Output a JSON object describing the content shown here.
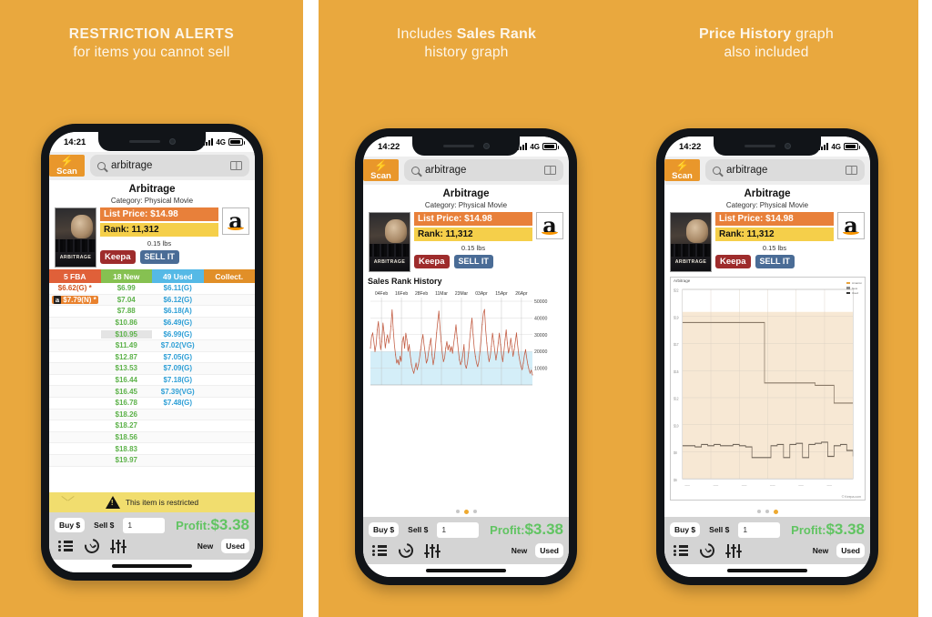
{
  "colors": {
    "promo_bg": "#e9a83e",
    "scan_orange": "#e9972b",
    "price_bar": "#e8803a",
    "rank_bar": "#f5cf4a",
    "profit_green": "#61c462",
    "restrict_yellow": "#f1dd6e",
    "fba_header": "#e06039",
    "new_header": "#86c151",
    "used_header": "#55b9e6",
    "collect_header": "#e18f28"
  },
  "panels": [
    {
      "id": "restriction-alerts",
      "promo": {
        "line1": "RESTRICTION ALERTS",
        "line2": "for items you cannot sell",
        "line1_bold": true
      },
      "status": {
        "time": "14:21",
        "network": "4G"
      },
      "search": {
        "scan_label": "Scan",
        "scan_icon": "bolt-icon",
        "value": "arbitrage",
        "placeholder": "Search",
        "book_icon": "book-icon",
        "search_icon": "search-icon"
      },
      "product": {
        "title": "Arbitrage",
        "category": "Category: Physical Movie",
        "cover_text": "ARBITRAGE",
        "list_price": "List Price:  $14.98",
        "rank": "Rank: 11,312",
        "weight": "0.15 lbs",
        "keepa_button": "Keepa",
        "sellit_button": "SELL IT",
        "amazon_logo": "amazon-logo"
      },
      "offers": {
        "headers": [
          "5 FBA",
          "18 New",
          "49 Used",
          "Collect."
        ],
        "rows": [
          {
            "fba": "$6.62(G) *",
            "fba_highlight": false,
            "fba_amazon": false,
            "new": "$6.99",
            "used": "$6.11(G)",
            "collect": ""
          },
          {
            "fba": "$7.79(N) *",
            "fba_highlight": true,
            "fba_amazon": true,
            "new": "$7.04",
            "used": "$6.12(G)",
            "collect": ""
          },
          {
            "fba": "",
            "fba_highlight": false,
            "fba_amazon": false,
            "new": "$7.88",
            "used": "$6.18(A)",
            "collect": ""
          },
          {
            "fba": "",
            "fba_highlight": false,
            "fba_amazon": false,
            "new": "$10.86",
            "used": "$6.49(G)",
            "collect": ""
          },
          {
            "fba": "",
            "fba_highlight": false,
            "fba_amazon": false,
            "new": "$10.95",
            "new_highlight": true,
            "used": "$6.99(G)",
            "collect": ""
          },
          {
            "fba": "",
            "fba_highlight": false,
            "fba_amazon": false,
            "new": "$11.49",
            "used": "$7.02(VG)",
            "collect": ""
          },
          {
            "fba": "",
            "fba_highlight": false,
            "fba_amazon": false,
            "new": "$12.87",
            "used": "$7.05(G)",
            "collect": ""
          },
          {
            "fba": "",
            "fba_highlight": false,
            "fba_amazon": false,
            "new": "$13.53",
            "used": "$7.09(G)",
            "collect": ""
          },
          {
            "fba": "",
            "fba_highlight": false,
            "fba_amazon": false,
            "new": "$16.44",
            "used": "$7.18(G)",
            "collect": ""
          },
          {
            "fba": "",
            "fba_highlight": false,
            "fba_amazon": false,
            "new": "$16.45",
            "used": "$7.39(VG)",
            "collect": ""
          },
          {
            "fba": "",
            "fba_highlight": false,
            "fba_amazon": false,
            "new": "$16.78",
            "used": "$7.48(G)",
            "collect": ""
          },
          {
            "fba": "",
            "fba_highlight": false,
            "fba_amazon": false,
            "new": "$18.26",
            "used": "",
            "collect": ""
          },
          {
            "fba": "",
            "fba_highlight": false,
            "fba_amazon": false,
            "new": "$18.27",
            "used": "",
            "collect": ""
          },
          {
            "fba": "",
            "fba_highlight": false,
            "fba_amazon": false,
            "new": "$18.56",
            "used": "",
            "collect": ""
          },
          {
            "fba": "",
            "fba_highlight": false,
            "fba_amazon": false,
            "new": "$18.83",
            "used": "",
            "collect": ""
          },
          {
            "fba": "",
            "fba_highlight": false,
            "fba_amazon": false,
            "new": "$19.97",
            "used": "",
            "collect": ""
          }
        ]
      },
      "restriction": {
        "text": "This item is restricted",
        "icon": "warning-triangle-icon"
      },
      "toolbar": {
        "buy_label": "Buy $",
        "sell_label": "Sell $",
        "qty_value": "1",
        "profit_label": "Profit:",
        "profit_value": "$3.38",
        "new_label": "New",
        "used_label": "Used",
        "icons": [
          "list-icon",
          "history-icon",
          "sliders-icon"
        ]
      }
    },
    {
      "id": "sales-rank-history",
      "promo": {
        "line1_plain": "Includes ",
        "line1_bold_text": "Sales Rank",
        "line2": "history graph"
      },
      "status": {
        "time": "14:22",
        "network": "4G"
      },
      "search": {
        "scan_label": "Scan",
        "value": "arbitrage"
      },
      "product": {
        "title": "Arbitrage",
        "category": "Category: Physical Movie",
        "cover_text": "ARBITRAGE",
        "list_price": "List Price:  $14.98",
        "rank": "Rank: 11,312",
        "weight": "0.15 lbs",
        "keepa_button": "Keepa",
        "sellit_button": "SELL IT"
      },
      "chart_title": "Sales Rank History",
      "dots": {
        "count": 3,
        "active": 1
      },
      "toolbar": {
        "buy_label": "Buy $",
        "sell_label": "Sell $",
        "qty_value": "1",
        "profit_label": "Profit:",
        "profit_value": "$3.38",
        "new_label": "New",
        "used_label": "Used"
      }
    },
    {
      "id": "price-history",
      "promo": {
        "line1_bold_text": "Price History",
        "line1_plain": " graph",
        "line2": "also included"
      },
      "status": {
        "time": "14:22",
        "network": "4G"
      },
      "search": {
        "scan_label": "Scan",
        "value": "arbitrage"
      },
      "product": {
        "title": "Arbitrage",
        "category": "Category: Physical Movie",
        "cover_text": "ARBITRAGE",
        "list_price": "List Price:  $14.98",
        "rank": "Rank: 11,312",
        "weight": "0.15 lbs",
        "keepa_button": "Keepa",
        "sellit_button": "SELL IT"
      },
      "keepa": {
        "label": "Arbitrage",
        "footer": "© Keepa.com",
        "legend": [
          "Amazon",
          "New",
          "Used"
        ]
      },
      "dots": {
        "count": 3,
        "active": 2
      },
      "toolbar": {
        "buy_label": "Buy $",
        "sell_label": "Sell $",
        "qty_value": "1",
        "profit_label": "Profit:",
        "profit_value": "$3.38",
        "new_label": "New",
        "used_label": "Used"
      }
    }
  ],
  "chart_data": [
    {
      "type": "line",
      "title": "Sales Rank History",
      "xlabel": "",
      "ylabel": "",
      "ylim": [
        0,
        50000
      ],
      "yticks": [
        10000,
        20000,
        30000,
        40000,
        50000
      ],
      "ytick_labels": [
        "10000",
        "20000",
        "30000",
        "40000",
        "50000"
      ],
      "xticks": [
        "04Feb",
        "16Feb",
        "28Feb",
        "11Mar",
        "23Mar",
        "03Apr",
        "15Apr",
        "26Apr"
      ],
      "grid": true,
      "legend": "none",
      "line_color": "#c1593f",
      "fill_color": "#d4eef8",
      "series": [
        {
          "name": "Sales Rank",
          "values": [
            22000,
            29000,
            31000,
            26000,
            20000,
            24000,
            33000,
            38000,
            28000,
            21000,
            26000,
            37000,
            31000,
            22000,
            27000,
            30000,
            25000,
            28000,
            35000,
            45000,
            33000,
            24000,
            18000,
            13000,
            15000,
            12000,
            17000,
            14000,
            26000,
            29000,
            22000,
            31000,
            27000,
            20000,
            24000,
            17000,
            12000,
            9000,
            7000,
            10000,
            13000,
            9000,
            12000,
            16000,
            21000,
            26000,
            30000,
            24000,
            19000,
            13000,
            15000,
            20000,
            24000,
            28000,
            18000,
            12000,
            16000,
            23000,
            31000,
            38000,
            44000,
            34000,
            26000,
            19000,
            14000,
            16000,
            22000,
            26000,
            21000,
            24000,
            20000,
            23000,
            19000,
            25000,
            30000,
            36000,
            28000,
            21000,
            15000,
            12000,
            14000,
            18000,
            24000,
            12000,
            10000,
            13000,
            19000,
            27000,
            34000,
            40000,
            30000,
            22000,
            17000,
            13000,
            11000,
            14000,
            20000,
            28000,
            36000,
            43000,
            45000,
            33000,
            25000,
            18000,
            14000,
            17000,
            23000,
            31000,
            26000,
            20000,
            15000,
            19000,
            25000,
            31000,
            24000,
            18000,
            14000,
            20000,
            27000,
            33000,
            25000,
            19000,
            22000,
            28000,
            23000,
            17000,
            21000,
            26000,
            31000,
            24000,
            18000,
            14000,
            11000,
            9000,
            13000,
            18000,
            21000,
            16000,
            12000,
            9000,
            7000,
            9000,
            6000
          ]
        }
      ]
    },
    {
      "type": "line",
      "title": "Price History",
      "grid": true,
      "legend": "top-right",
      "background": "#f7e8d4",
      "line_color": "#8a7a68",
      "series": [
        {
          "name": "Amazon/List",
          "values": [
            18.7,
            18.7,
            18.7,
            18.7,
            18.7,
            18.7,
            18.7,
            18.7,
            18.7,
            18.7,
            18.7,
            18.7,
            18.7,
            13.6,
            13.6,
            13.6,
            13.6,
            13.6,
            13.6,
            13.6,
            13.6,
            13.4,
            13.4,
            13.4,
            11.9,
            11.9,
            11.9,
            11.9
          ]
        },
        {
          "name": "Used/New",
          "values": [
            8.3,
            8.3,
            8.2,
            8.4,
            8.3,
            8.4,
            8.3,
            8.3,
            8.4,
            8.3,
            8.2,
            7.3,
            7.3,
            7.3,
            8.3,
            8.4,
            7.3,
            8.4,
            8.5,
            7.3,
            8.4,
            8.5,
            8.6,
            7.4,
            8.3,
            8.4,
            7.9,
            7.4
          ]
        }
      ]
    }
  ]
}
